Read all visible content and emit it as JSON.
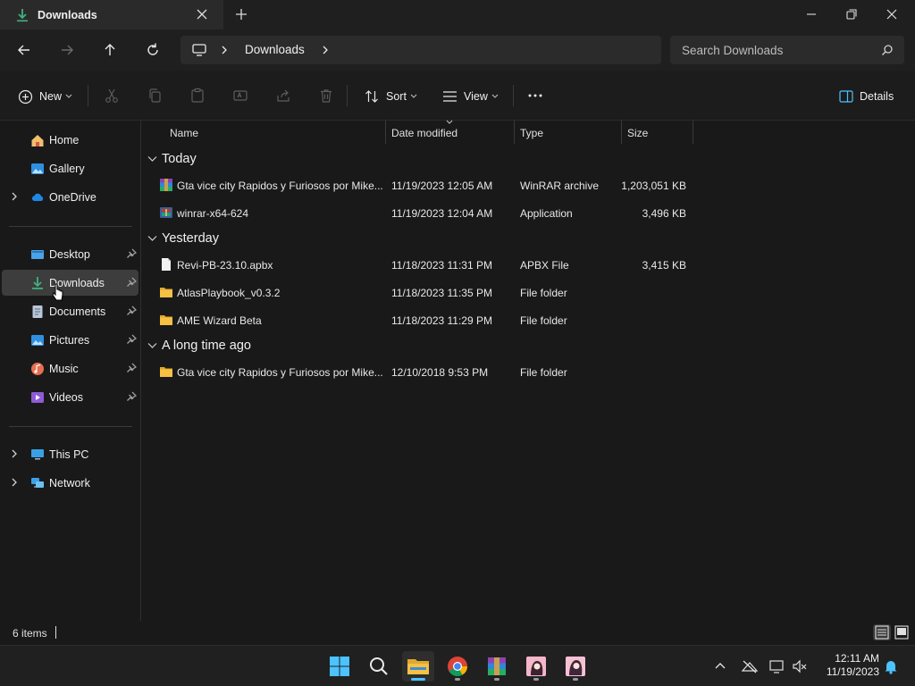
{
  "window": {
    "tab_title": "Downloads"
  },
  "address": {
    "crumb": "Downloads"
  },
  "search": {
    "placeholder": "Search Downloads"
  },
  "toolbar": {
    "new_label": "New",
    "sort_label": "Sort",
    "view_label": "View",
    "details_label": "Details"
  },
  "sidebar": {
    "items": [
      {
        "label": "Home",
        "icon": "home-icon"
      },
      {
        "label": "Gallery",
        "icon": "gallery-icon"
      },
      {
        "label": "OneDrive",
        "icon": "onedrive-icon"
      },
      {
        "label": "Desktop",
        "icon": "desktop-icon"
      },
      {
        "label": "Downloads",
        "icon": "downloads-icon"
      },
      {
        "label": "Documents",
        "icon": "documents-icon"
      },
      {
        "label": "Pictures",
        "icon": "pictures-icon"
      },
      {
        "label": "Music",
        "icon": "music-icon"
      },
      {
        "label": "Videos",
        "icon": "videos-icon"
      },
      {
        "label": "This PC",
        "icon": "this-pc-icon"
      },
      {
        "label": "Network",
        "icon": "network-icon"
      }
    ]
  },
  "columns": {
    "name": "Name",
    "date": "Date modified",
    "type": "Type",
    "size": "Size"
  },
  "groups": [
    {
      "label": "Today",
      "rows": [
        {
          "name": "Gta vice city Rapidos y Furiosos por Mike...",
          "date": "11/19/2023 12:05 AM",
          "type": "WinRAR archive",
          "size": "1,203,051 KB",
          "icon": "winrar-archive-icon"
        },
        {
          "name": "winrar-x64-624",
          "date": "11/19/2023 12:04 AM",
          "type": "Application",
          "size": "3,496 KB",
          "icon": "winrar-installer-icon"
        }
      ]
    },
    {
      "label": "Yesterday",
      "rows": [
        {
          "name": "Revi-PB-23.10.apbx",
          "date": "11/18/2023 11:31 PM",
          "type": "APBX File",
          "size": "3,415 KB",
          "icon": "file-icon"
        },
        {
          "name": "AtlasPlaybook_v0.3.2",
          "date": "11/18/2023 11:35 PM",
          "type": "File folder",
          "size": "",
          "icon": "folder-icon"
        },
        {
          "name": "AME Wizard Beta",
          "date": "11/18/2023 11:29 PM",
          "type": "File folder",
          "size": "",
          "icon": "folder-icon"
        }
      ]
    },
    {
      "label": "A long time ago",
      "rows": [
        {
          "name": "Gta vice city Rapidos y Furiosos por Mike...",
          "date": "12/10/2018 9:53 PM",
          "type": "File folder",
          "size": "",
          "icon": "folder-icon"
        }
      ]
    }
  ],
  "status": {
    "count": "6 items"
  },
  "clock": {
    "time": "12:11 AM",
    "date": "11/19/2023"
  },
  "colors": {
    "accent": "#4cc2ff",
    "folder": "#f5c043",
    "download_green": "#3fb27f"
  }
}
